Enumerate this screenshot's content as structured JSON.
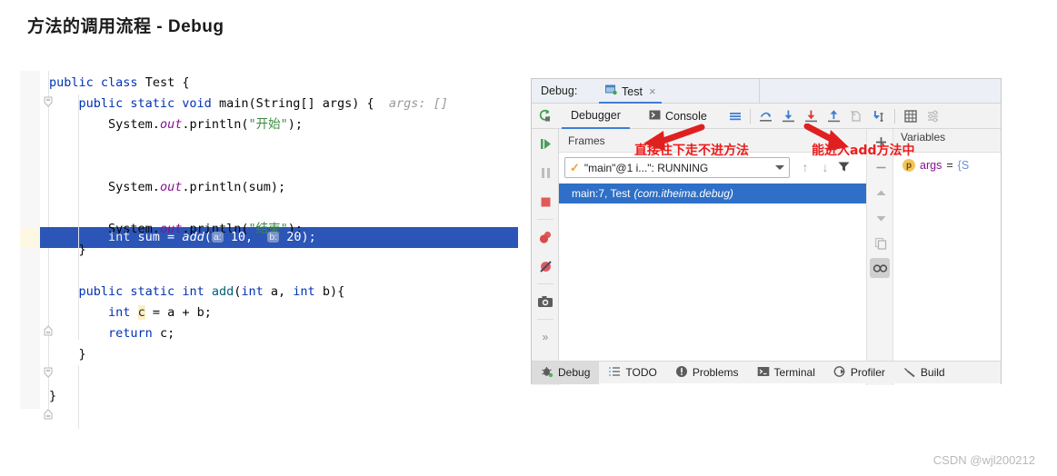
{
  "page": {
    "title": "方法的调用流程 - Debug",
    "watermark": "CSDN @wjl200212"
  },
  "code": {
    "language": "java",
    "lines": [
      {
        "text": "public class Test {",
        "indent": 0
      },
      {
        "text": "public static void main(String[] args) {",
        "indent": 1,
        "inlay": "args: []"
      },
      {
        "text": "System.out.println(\"开始\");",
        "indent": 2
      },
      {
        "text": "",
        "indent": 0
      },
      {
        "text": "int sum = add( a: 10,  b: 20);",
        "indent": 2,
        "executing": true
      },
      {
        "text": "System.out.println(sum);",
        "indent": 2
      },
      {
        "text": "",
        "indent": 0
      },
      {
        "text": "System.out.println(\"结束\");",
        "indent": 2
      },
      {
        "text": "}",
        "indent": 1
      },
      {
        "text": "",
        "indent": 0
      },
      {
        "text": "public static int add(int a, int b){",
        "indent": 1
      },
      {
        "text": "int c = a + b;",
        "indent": 2
      },
      {
        "text": "return c;",
        "indent": 2
      },
      {
        "text": "}",
        "indent": 1
      },
      {
        "text": "}",
        "indent": 0
      }
    ],
    "inlay_args": "args: []",
    "param_hint_a": "a:",
    "param_hint_b": "b:",
    "highlighted_variable": "c",
    "executing_line_number": 7
  },
  "debug_window": {
    "titlebar": {
      "label": "Debug:",
      "run_config_name": "Test",
      "close_label": "×"
    },
    "toolbar": {
      "rerun_icon": "rerun-icon",
      "tabs": [
        {
          "label": "Debugger",
          "active": true
        },
        {
          "label": "Console",
          "active": false
        }
      ],
      "icons": [
        "show-execution-point-icon",
        "step-over-icon",
        "step-into-icon",
        "force-step-into-icon",
        "step-out-icon",
        "drop-frame-icon",
        "run-to-cursor-icon",
        "evaluate-expression-icon",
        "settings-icon"
      ]
    },
    "run_controls": [
      "resume-program-icon",
      "pause-program-icon",
      "stop-icon",
      "view-breakpoints-icon",
      "mute-breakpoints-icon",
      "snapshot-icon",
      "expand-more-icon"
    ],
    "frames": {
      "title": "Frames",
      "thread_status": "\"main\"@1 i...\": RUNNING",
      "thread_check": "✓",
      "nav_up": "↑",
      "nav_down": "↓",
      "filter_icon": "filter-icon",
      "stack": [
        {
          "location": "main:7, Test",
          "package": "(com.itheima.debug)",
          "selected": true
        }
      ]
    },
    "watch_toolbar": [
      "add-icon",
      "remove-icon",
      "move-up-icon",
      "move-down-icon",
      "copy-icon",
      "watches-icon"
    ],
    "variables": {
      "title": "Variables",
      "rows": [
        {
          "badge": "p",
          "name": "args",
          "equals": "=",
          "value": "{S"
        }
      ]
    },
    "bottom_tabs": [
      {
        "label": "Debug",
        "icon": "debug-icon",
        "active": true
      },
      {
        "label": "TODO",
        "icon": "todo-icon",
        "active": false
      },
      {
        "label": "Problems",
        "icon": "problems-icon",
        "active": false
      },
      {
        "label": "Terminal",
        "icon": "terminal-icon",
        "active": false
      },
      {
        "label": "Profiler",
        "icon": "profiler-icon",
        "active": false
      },
      {
        "label": "Build",
        "icon": "build-icon",
        "active": false
      }
    ]
  },
  "annotations": [
    {
      "text": "直接往下走不进方法",
      "points_to": "step-over-icon"
    },
    {
      "text": "能进入add方法中",
      "points_to": "step-into-icon"
    }
  ],
  "colors": {
    "accent_blue": "#2b55b7",
    "selection_blue": "#2f6fc7",
    "annotation_red": "#ee1c1c",
    "keyword": "#0033b3",
    "string": "#3d8b40",
    "method": "#00627a",
    "field": "#871094"
  }
}
